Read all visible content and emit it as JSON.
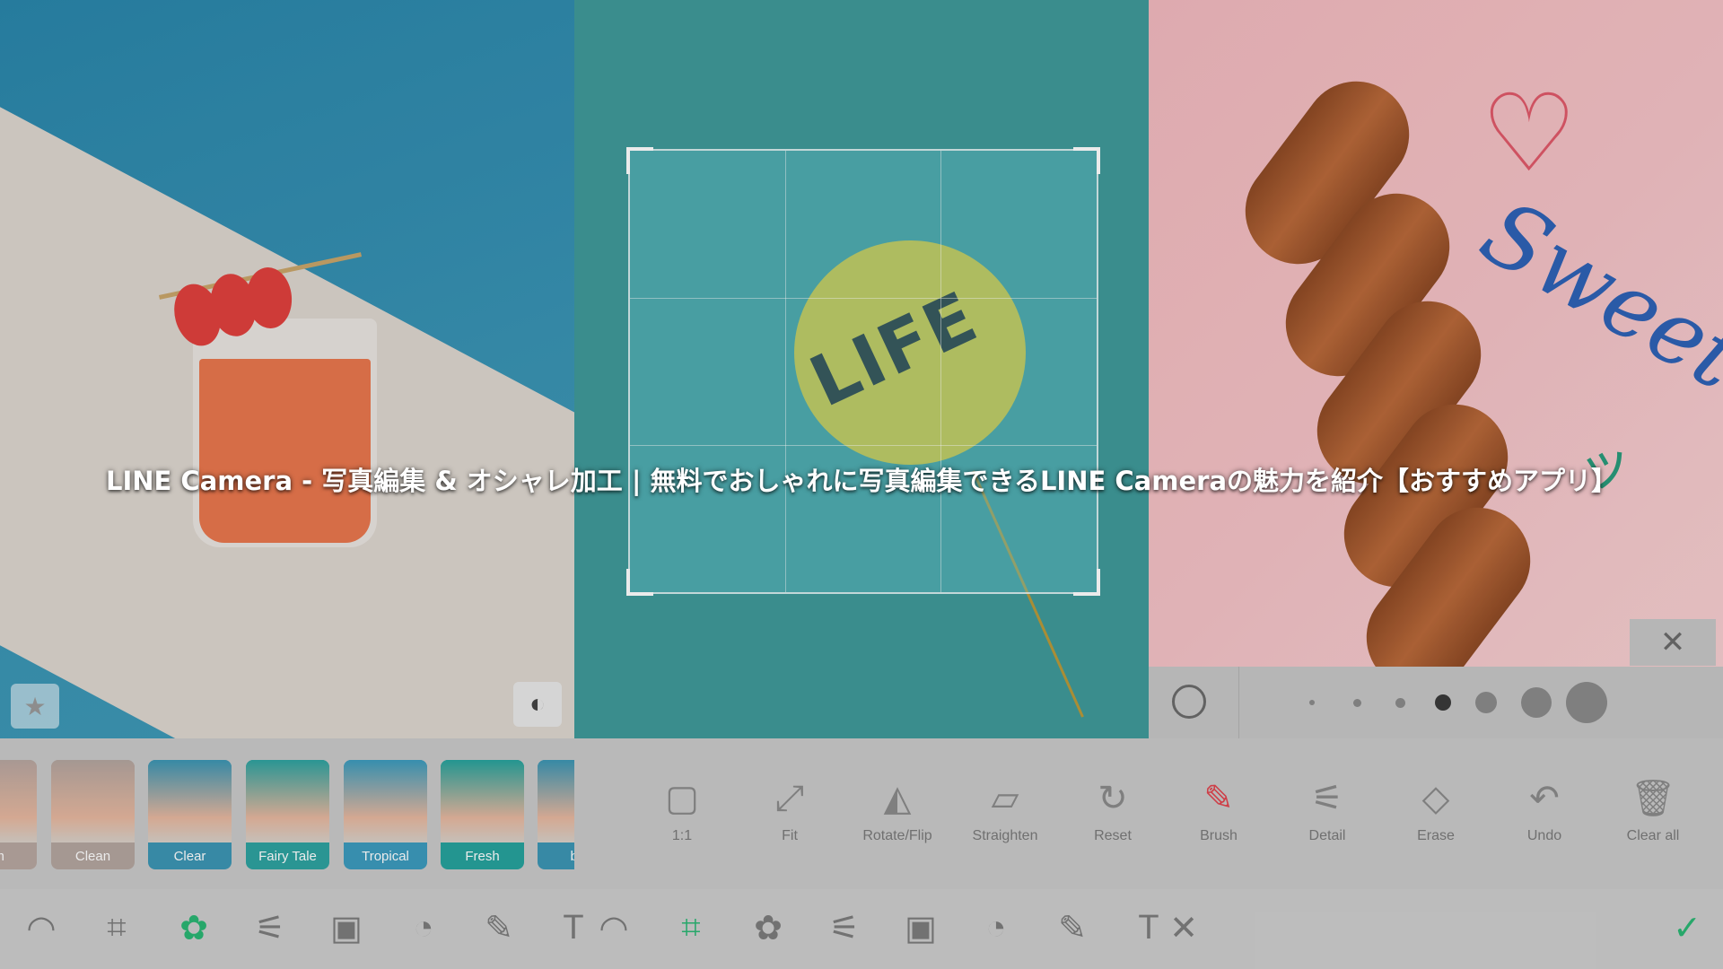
{
  "headline": "LINE Camera - 写真編集 & オシャレ加工 | 無料でおしゃれに写真編集できるLINE Cameraの魅力を紹介【おすすめアプリ】",
  "left_panel": {
    "filters": [
      {
        "label": "am",
        "color": "#b7a6a0"
      },
      {
        "label": "Clean",
        "color": "#b3a59f"
      },
      {
        "label": "Clear",
        "color": "#3c95b3"
      },
      {
        "label": "Fairy Tale",
        "color": "#2ea2a0"
      },
      {
        "label": "Tropical",
        "color": "#3c9bbd"
      },
      {
        "label": "Fresh",
        "color": "#27a29d"
      },
      {
        "label": "blu",
        "color": "#3c95b3"
      }
    ],
    "selected_filter": "Clear",
    "icons": {
      "favorite": "star-icon",
      "brightness": "brightness-icon"
    }
  },
  "crop_panel": {
    "tools": [
      {
        "label": "1:1",
        "icon": "square-icon",
        "glyph": "▢"
      },
      {
        "label": "Fit",
        "icon": "expand-icon",
        "glyph": "⤢"
      },
      {
        "label": "Rotate/Flip",
        "icon": "flip-icon",
        "glyph": "◭"
      },
      {
        "label": "Straighten",
        "icon": "straighten-icon",
        "glyph": "▱"
      },
      {
        "label": "Reset",
        "icon": "reset-icon",
        "glyph": "↻"
      }
    ],
    "balloon_text": "LIFE"
  },
  "brush_panel": {
    "tools": [
      {
        "label": "Brush",
        "icon": "brush-icon",
        "glyph": "✎",
        "active": true
      },
      {
        "label": "Detail",
        "icon": "sliders-icon",
        "glyph": "⚟",
        "active": false
      },
      {
        "label": "Erase",
        "icon": "eraser-icon",
        "glyph": "◇",
        "active": false
      },
      {
        "label": "Undo",
        "icon": "undo-icon",
        "glyph": "↶",
        "active": false
      },
      {
        "label": "Clear all",
        "icon": "trash-icon",
        "glyph": "🗑",
        "active": false
      }
    ],
    "sticker_text": "Sweet",
    "selected_size_index": 3
  },
  "bottom_bar": {
    "icons": [
      "template-icon",
      "crop-icon",
      "filter-icon",
      "adjust-icon",
      "frame-icon",
      "sticker-icon",
      "brush-icon",
      "text-icon",
      "template-icon",
      "crop-icon",
      "filter-icon",
      "adjust-icon",
      "frame-icon",
      "sticker-icon",
      "brush-icon",
      "text-icon",
      "close-icon"
    ],
    "confirm_icon": "check-icon"
  },
  "colors": {
    "accent_green": "#2bb673",
    "brush_red": "#e0454f",
    "selected_filter": "#3c95b3"
  }
}
